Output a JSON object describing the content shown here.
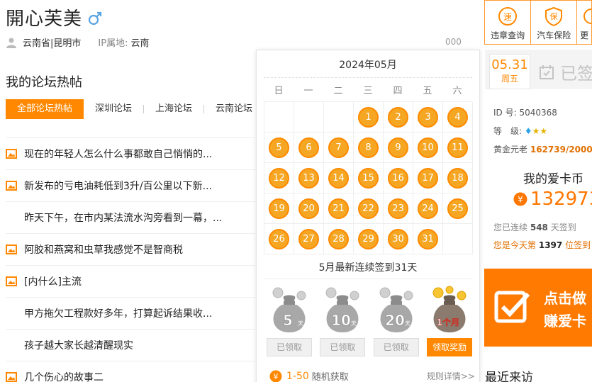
{
  "profile": {
    "username": "開心芙美",
    "location": "云南省|昆明市",
    "ip_label": "IP属地:",
    "ip_value": "云南",
    "count": "000"
  },
  "forum": {
    "section_title": "我的论坛热帖",
    "tabs": [
      {
        "label": "全部论坛热帖",
        "active": true
      },
      {
        "label": "深圳论坛",
        "active": false
      },
      {
        "label": "上海论坛",
        "active": false
      },
      {
        "label": "云南论坛",
        "active": false
      }
    ],
    "posts": [
      {
        "title": "现在的年轻人怎么什么事都敢自己悄悄的...",
        "has_image": true
      },
      {
        "title": "新发布的亏电油耗低到3升/百公里以下新...",
        "has_image": true
      },
      {
        "title": "昨天下午，在市内某法流水沟旁看到一幕，...",
        "has_image": false
      },
      {
        "title": "阿胶和燕窝和虫草我感觉不是智商税",
        "has_image": true
      },
      {
        "title": "[内什么]主流",
        "has_image": true
      },
      {
        "title": "甲方拖欠工程款好多年，打算起诉结果收...",
        "has_image": false
      },
      {
        "title": "孩子越大家长越清醒现实",
        "has_image": false
      },
      {
        "title": "几个伤心的故事二",
        "has_image": true
      }
    ]
  },
  "calendar": {
    "month_title": "2024年05月",
    "weekdays": [
      "日",
      "一",
      "二",
      "三",
      "四",
      "五",
      "六"
    ],
    "leading_blanks": 3,
    "days": [
      1,
      2,
      3,
      4,
      5,
      6,
      7,
      8,
      9,
      10,
      11,
      12,
      13,
      14,
      15,
      16,
      17,
      18,
      19,
      20,
      21,
      22,
      23,
      24,
      25,
      26,
      27,
      28,
      29,
      30,
      31
    ],
    "checked_days": [
      1,
      2,
      3,
      4,
      5,
      6,
      7,
      8,
      9,
      10,
      11,
      12,
      13,
      14,
      15,
      16,
      17,
      18,
      19,
      20,
      21,
      22,
      23,
      24,
      25,
      26,
      27,
      28,
      29,
      30,
      31
    ],
    "streak_text": "5月最新连续签到31天",
    "rewards": [
      {
        "amount": "5",
        "unit": "天",
        "button": "已领取",
        "claimable": false
      },
      {
        "amount": "10",
        "unit": "天",
        "button": "已领取",
        "claimable": false
      },
      {
        "amount": "20",
        "unit": "天",
        "button": "已领取",
        "claimable": false
      },
      {
        "amount": "1个月",
        "unit": "",
        "button": "领取奖励",
        "claimable": true
      }
    ],
    "footer_range": "1-50",
    "footer_random": "随机获取",
    "footer_rules": "规则详情>>"
  },
  "toolbar": {
    "items": [
      {
        "label": "违章查询",
        "icon": "speed-icon"
      },
      {
        "label": "汽车保险",
        "icon": "insurance-icon"
      },
      {
        "label": "更",
        "icon": "more-icon"
      }
    ]
  },
  "checkin": {
    "date": "05.31",
    "weekday": "周五",
    "status": "已签"
  },
  "user_info": {
    "id_label": "ID 号:",
    "id_value": "5040368",
    "level_label": "等　级:",
    "gold_label": "黄金元老",
    "gold_value": "162739/20000"
  },
  "coins": {
    "title": "我的爱卡币",
    "amount": "132973",
    "streak_prefix": "您已连续",
    "streak_days": "548",
    "streak_suffix": "天签到",
    "rank_prefix": "您是今天第",
    "rank_num": "1397",
    "rank_suffix": "位签到"
  },
  "banner": {
    "line1": "点击做",
    "line2": "赚爱卡"
  },
  "visitors": {
    "title": "最近来访"
  },
  "colors": {
    "accent": "#ff8800",
    "dot": "#f5a623",
    "coin": "#ff7700"
  }
}
